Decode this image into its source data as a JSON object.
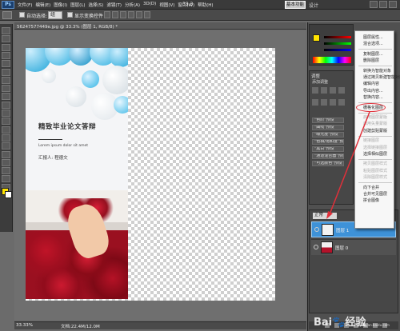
{
  "menubar": {
    "menus": [
      "文件(F)",
      "编辑(E)",
      "图像(I)",
      "图层(L)",
      "选择(S)",
      "滤镜(T)",
      "分析(A)",
      "3D(D)",
      "视图(V)",
      "窗口(W)",
      "帮助(H)"
    ],
    "zoom": "33.3",
    "workspace_button": "基本功能",
    "workspace_alt": "设计"
  },
  "options": {
    "auto_select_label": "自动选择:",
    "auto_select_value": "组",
    "show_transform_label": "显示变换控件"
  },
  "document": {
    "tab_title": "56247577449e.jpg @ 33.3% (图层 1, RGB/8) *",
    "cover_title": "精致毕业论文答辩",
    "cover_subtitle": "Lorem ipsum dolor sit amet",
    "cover_author": "汇报人: 程德文"
  },
  "status": {
    "zoom": "33.33%",
    "doc_size": "文档:22.4M/12.0M"
  },
  "adjustments": {
    "header": "调整",
    "add_adjustment": "添加调整",
    "presets": [
      "\"色阶\"预设",
      "\"曲线\"预设",
      "\"曝光度\"预设",
      "\"色相/饱和度\"预设",
      "\"黑白\"预设",
      "\"通道混合器\"预设",
      "\"可选颜色\"预设"
    ]
  },
  "layers": {
    "blend_mode": "正常",
    "items": [
      {
        "name": "图层 1",
        "selected": true
      },
      {
        "name": "图层 0",
        "selected": false
      }
    ]
  },
  "context_menu": {
    "items": [
      {
        "label": "图层属性...",
        "disabled": false
      },
      {
        "label": "混合选项...",
        "disabled": false
      },
      {
        "sep": true
      },
      {
        "label": "复制图层...",
        "disabled": false
      },
      {
        "label": "删除图层",
        "disabled": false
      },
      {
        "sep": true
      },
      {
        "label": "转换为智能对象",
        "disabled": false
      },
      {
        "label": "通过拷贝新建智能对象",
        "disabled": false
      },
      {
        "label": "编辑内容",
        "disabled": false
      },
      {
        "label": "导出内容...",
        "disabled": false
      },
      {
        "label": "替换内容...",
        "disabled": false
      },
      {
        "sep": true
      },
      {
        "label": "栅格化图层",
        "disabled": false,
        "highlight": true
      },
      {
        "sep": true
      },
      {
        "label": "启用图层蒙版",
        "disabled": true
      },
      {
        "label": "启用矢量蒙版",
        "disabled": true
      },
      {
        "label": "创建剪贴蒙版",
        "disabled": false
      },
      {
        "sep": true
      },
      {
        "label": "链接图层",
        "disabled": true
      },
      {
        "label": "选择链接图层",
        "disabled": true
      },
      {
        "label": "选择相似图层",
        "disabled": false
      },
      {
        "sep": true
      },
      {
        "label": "拷贝图层样式",
        "disabled": true
      },
      {
        "label": "粘贴图层样式",
        "disabled": true
      },
      {
        "label": "清除图层样式",
        "disabled": true
      },
      {
        "sep": true
      },
      {
        "label": "向下合并",
        "disabled": false
      },
      {
        "label": "合并可见图层",
        "disabled": false
      },
      {
        "label": "拼合图像",
        "disabled": false
      }
    ]
  },
  "watermark": {
    "main": "Bai🐾经验",
    "sub": "jingyan.baidu.com"
  },
  "colors": {
    "accent": "#3e92d8",
    "highlight_ring": "#e0303a",
    "foreground": "#ffe300"
  }
}
